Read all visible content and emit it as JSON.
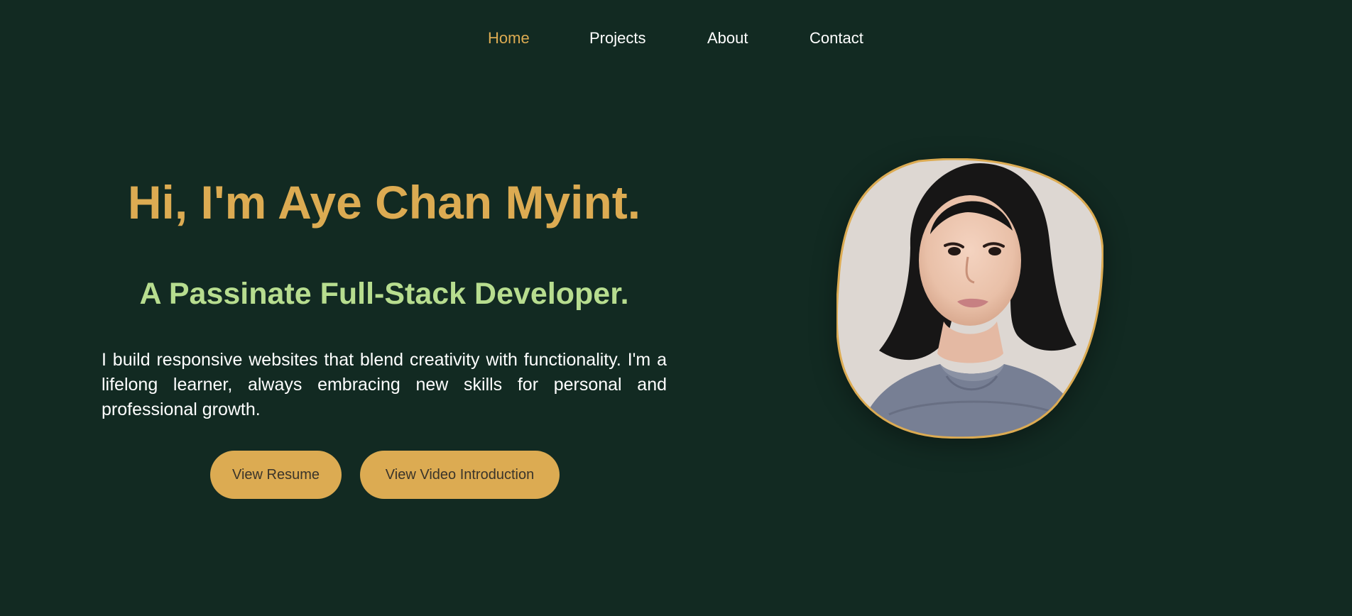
{
  "nav": {
    "items": [
      {
        "label": "Home",
        "active": true
      },
      {
        "label": "Projects",
        "active": false
      },
      {
        "label": "About",
        "active": false
      },
      {
        "label": "Contact",
        "active": false
      }
    ]
  },
  "hero": {
    "title": "Hi, I'm Aye Chan Myint.",
    "subtitle": "A Passinate Full-Stack Developer.",
    "intro": "I build responsive websites that blend creativity with functionality. I'm a lifelong learner, always embracing new skills for personal and professional growth.",
    "buttons": {
      "resume_label": "View Resume",
      "video_label": "View Video Introduction"
    }
  },
  "colors": {
    "background": "#122a22",
    "accent": "#dcab52",
    "subtitle": "#b7dd8f",
    "text": "#ffffff"
  }
}
